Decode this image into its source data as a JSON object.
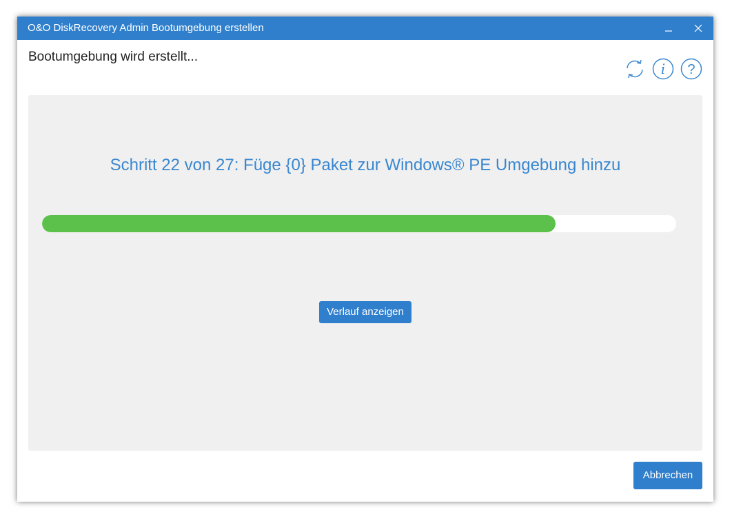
{
  "window": {
    "title": "O&O DiskRecovery Admin Bootumgebung erstellen",
    "minimize_icon": "minimize-icon",
    "close_icon": "close-icon"
  },
  "header": {
    "status": "Bootumgebung wird erstellt...",
    "icons": [
      "refresh-icon",
      "info-icon",
      "help-icon"
    ]
  },
  "progress": {
    "step_text": "Schritt 22 von 27: Füge {0} Paket zur Windows® PE Umgebung hinzu",
    "fraction": 0.81
  },
  "buttons": {
    "history_label": "Verlauf anzeigen",
    "cancel_label": "Abbrechen"
  },
  "colors": {
    "titlebar": "#2f7fcd",
    "accent_text": "#3a87cf",
    "progress_fill": "#5bc14a",
    "panel_background": "#f0f0f0"
  }
}
